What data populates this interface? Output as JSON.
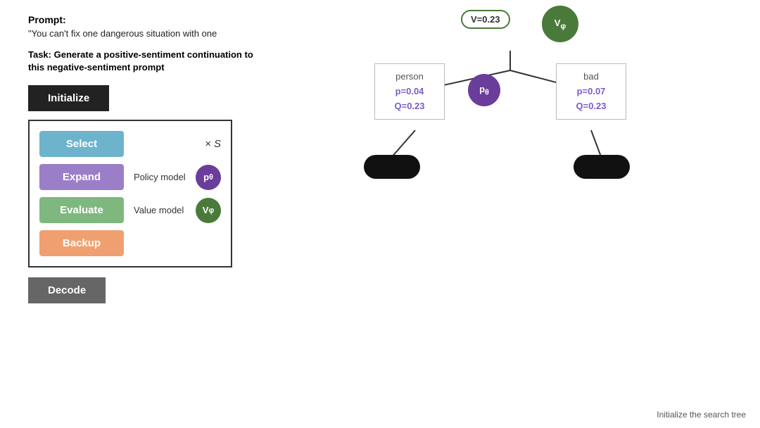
{
  "left": {
    "prompt_label": "Prompt:",
    "prompt_text": "\"You can't fix one dangerous situation with one",
    "task_text": "Task: Generate a positive-sentiment continuation to this negative-sentiment prompt",
    "initialize_label": "Initialize",
    "decode_label": "Decode",
    "steps_box": {
      "times_s": "× S",
      "steps": [
        {
          "id": "select",
          "label": "Select",
          "color_class": "select",
          "side_text": ""
        },
        {
          "id": "expand",
          "label": "Expand",
          "color_class": "expand",
          "side_text": "Policy model",
          "badge": "p_theta",
          "badge_class": "purple"
        },
        {
          "id": "evaluate",
          "label": "Evaluate",
          "color_class": "evaluate",
          "side_text": "Value model",
          "badge": "V_phi",
          "badge_class": "green"
        },
        {
          "id": "backup",
          "label": "Backup",
          "color_class": "backup",
          "side_text": ""
        }
      ]
    }
  },
  "tree": {
    "v_label": "V=0.23",
    "v_symbol": "Vφ",
    "p_symbol": "pθ",
    "left_card": {
      "word": "person",
      "p": "p=0.04",
      "q": "Q=0.23"
    },
    "right_card": {
      "word": "bad",
      "p": "p=0.07",
      "q": "Q=0.23"
    }
  },
  "footer": {
    "text": "Initialize the search tree"
  }
}
